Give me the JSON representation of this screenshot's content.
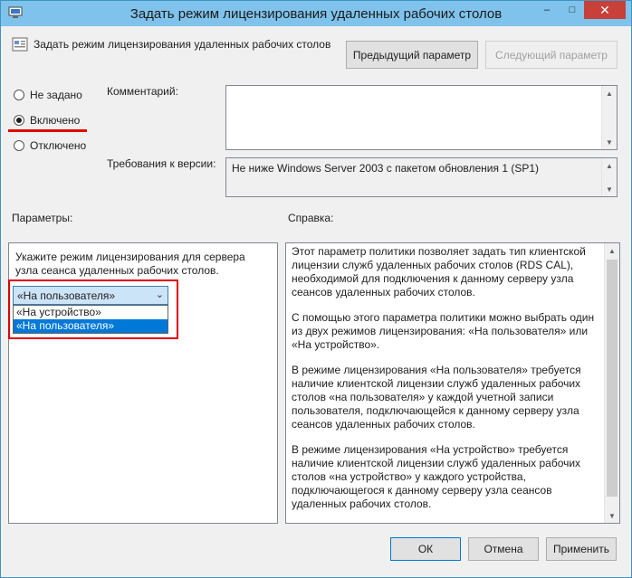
{
  "window": {
    "title": "Задать режим лицензирования удаленных рабочих столов",
    "controls": {
      "minimize": "–",
      "maximize": "□",
      "close": "✕"
    }
  },
  "header": {
    "policy_name": "Задать режим лицензирования удаленных рабочих столов",
    "prev_button": "Предыдущий параметр",
    "next_button": "Следующий параметр"
  },
  "state": {
    "options": [
      {
        "label": "Не задано",
        "checked": false
      },
      {
        "label": "Включено",
        "checked": true
      },
      {
        "label": "Отключено",
        "checked": false
      }
    ]
  },
  "comment": {
    "label": "Комментарий:",
    "value": ""
  },
  "requirements": {
    "label": "Требования к версии:",
    "value": "Не ниже Windows Server 2003 с пакетом обновления 1 (SP1)"
  },
  "params": {
    "label": "Параметры:",
    "description": "Укажите режим лицензирования для сервера узла сеанса удаленных рабочих столов.",
    "combo_value": "«На пользователя»",
    "options": [
      "«На устройство»",
      "«На пользователя»"
    ],
    "selected_index": 1
  },
  "help": {
    "label": "Справка:",
    "paragraphs": [
      "Этот параметр политики позволяет задать тип клиентской лицензии служб удаленных рабочих столов (RDS CAL), необходимой для подключения к данному серверу узла сеансов удаленных рабочих столов.",
      "С помощью этого параметра политики можно выбрать один из двух режимов лицензирования: «На пользователя» или «На устройство».",
      "В режиме лицензирования «На пользователя» требуется наличие клиентской лицензии служб удаленных рабочих столов «на пользователя» у каждой учетной записи пользователя, подключающейся к данному серверу узла сеансов удаленных рабочих столов.",
      "В режиме лицензирования «На устройство» требуется наличие клиентской лицензии служб удаленных рабочих столов «на устройство» у каждого устройства, подключающегося к данному серверу узла сеансов удаленных рабочих столов."
    ]
  },
  "footer": {
    "ok": "ОК",
    "cancel": "Отмена",
    "apply": "Применить"
  },
  "colors": {
    "titlebar": "#7fc3ec",
    "close": "#c7403a",
    "highlight": "#0078d7",
    "annotation": "#e00000"
  }
}
